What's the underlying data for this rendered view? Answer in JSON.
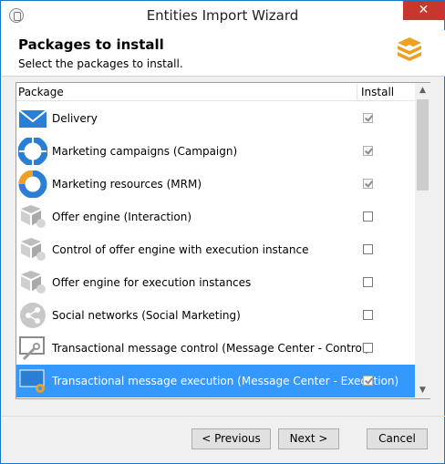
{
  "window": {
    "title": "Entities Import Wizard",
    "close_glyph": "✕"
  },
  "header": {
    "title": "Packages to install",
    "subtitle": "Select the packages to install."
  },
  "list": {
    "columns": {
      "package": "Package",
      "install": "Install"
    },
    "rows": [
      {
        "label": "Delivery",
        "icon": "envelope-icon",
        "checked": true,
        "selected": false
      },
      {
        "label": "Marketing campaigns (Campaign)",
        "icon": "campaign-icon",
        "checked": true,
        "selected": false
      },
      {
        "label": "Marketing resources (MRM)",
        "icon": "mrm-icon",
        "checked": true,
        "selected": false
      },
      {
        "label": "Offer engine (Interaction)",
        "icon": "offer-engine-icon",
        "checked": false,
        "selected": false
      },
      {
        "label": "Control of offer engine with execution instance",
        "icon": "offer-engine-icon",
        "checked": false,
        "selected": false
      },
      {
        "label": "Offer engine for execution instances",
        "icon": "offer-engine-icon",
        "checked": false,
        "selected": false
      },
      {
        "label": "Social networks (Social Marketing)",
        "icon": "social-icon",
        "checked": false,
        "selected": false
      },
      {
        "label": "Transactional message control (Message Center - Control)",
        "icon": "message-control-icon",
        "checked": false,
        "selected": false
      },
      {
        "label": "Transactional message execution (Message Center - Execution)",
        "icon": "message-execution-icon",
        "checked": true,
        "selected": true
      }
    ]
  },
  "buttons": {
    "previous": "< Previous",
    "next": "Next >",
    "cancel": "Cancel"
  },
  "colors": {
    "selection": "#3399ff",
    "accent_blue": "#2a7fd4",
    "accent_orange": "#f0a020",
    "close_red": "#c7372f"
  }
}
